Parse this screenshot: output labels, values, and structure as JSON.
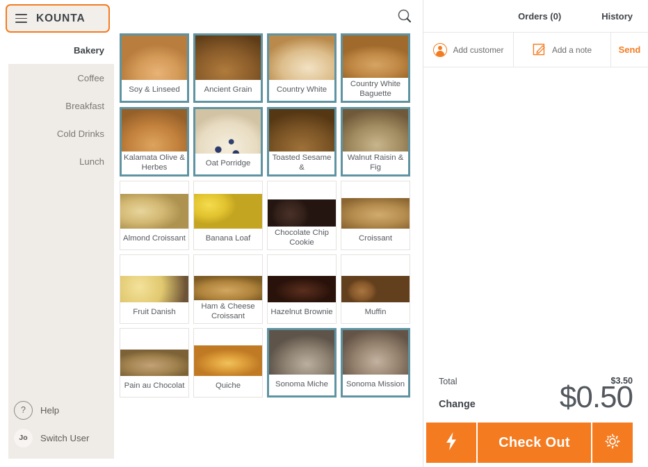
{
  "brand": {
    "name": "KOUNTA",
    "menu_icon": "hamburger-icon"
  },
  "sidebar": {
    "items": [
      {
        "label": "Bakery",
        "active": true
      },
      {
        "label": "Coffee",
        "active": false
      },
      {
        "label": "Breakfast",
        "active": false
      },
      {
        "label": "Cold Drinks",
        "active": false
      },
      {
        "label": "Lunch",
        "active": false
      }
    ],
    "footer": {
      "help_label": "Help",
      "help_glyph": "?",
      "switch_user_label": "Switch User",
      "user_initials": "Jo"
    }
  },
  "topbar": {
    "search_icon": "search-icon"
  },
  "products": [
    {
      "name": "Soy & Linseed",
      "selected": true
    },
    {
      "name": "Ancient Grain",
      "selected": true
    },
    {
      "name": "Country White",
      "selected": true
    },
    {
      "name": "Country White Baguette",
      "selected": true
    },
    {
      "name": "Kalamata Olive & Herbes",
      "selected": true
    },
    {
      "name": "Oat Porridge",
      "selected": true
    },
    {
      "name": "Toasted Sesame &",
      "selected": true
    },
    {
      "name": "Walnut Raisin & Fig",
      "selected": true
    },
    {
      "name": "Almond Croissant",
      "selected": false
    },
    {
      "name": "Banana Loaf",
      "selected": false
    },
    {
      "name": "Chocolate Chip Cookie",
      "selected": false
    },
    {
      "name": "Croissant",
      "selected": false
    },
    {
      "name": "Fruit Danish",
      "selected": false
    },
    {
      "name": "Ham & Cheese Croissant",
      "selected": false
    },
    {
      "name": "Hazelnut Brownie",
      "selected": false
    },
    {
      "name": "Muffin",
      "selected": false
    },
    {
      "name": "Pain au Chocolat",
      "selected": false
    },
    {
      "name": "Quiche",
      "selected": false
    },
    {
      "name": "Sonoma Miche",
      "selected": true
    },
    {
      "name": "Sonoma Mission",
      "selected": true
    }
  ],
  "order_panel": {
    "orders_label": "Orders (0)",
    "history_label": "History",
    "add_customer_label": "Add customer",
    "add_note_label": "Add a note",
    "send_label": "Send",
    "total_label": "Total",
    "total_amount": "$3.50",
    "change_label": "Change",
    "change_amount": "$0.50",
    "checkout_label": "Check Out",
    "lightning_icon": "lightning-bolt-icon",
    "gear_icon": "gear-icon",
    "customer_icon": "person-circle-icon",
    "note_icon": "note-pencil-icon"
  },
  "colors": {
    "accent_orange": "#F47B20",
    "tile_selected_border": "#5E93A2",
    "sidebar_bg": "#EFEBE7",
    "text_dark": "#3E4348"
  }
}
